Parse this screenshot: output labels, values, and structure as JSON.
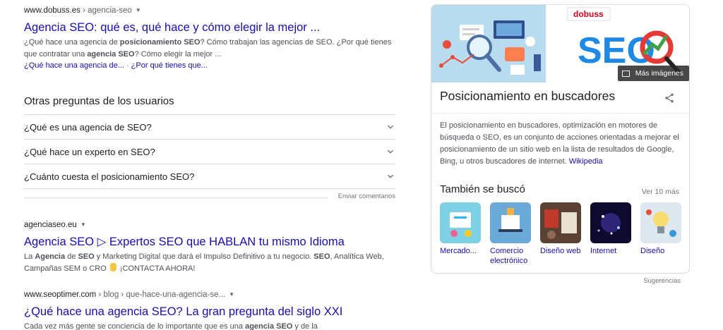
{
  "results": [
    {
      "domain": "www.dobuss.es",
      "path": " › agencia-seo",
      "title": "Agencia SEO: qué es, qué hace y cómo elegir la mejor ...",
      "snippet_html": "¿Qué hace una agencia de <b>posicionamiento SEO</b>? Cómo trabajan las agencias de SEO. ¿Por qué tienes que contratar una <b>agencia SEO</b>? Cómo elegir la mejor ...",
      "sitelinks": [
        "¿Qué hace una agencia de...",
        "¿Por qué tienes que..."
      ]
    },
    {
      "domain": "agenciaseo.eu",
      "path": "",
      "title": "Agencia SEO ▷ Expertos SEO que HABLAN tu mismo Idioma",
      "snippet_html": "La <b>Agencia</b> de <b>SEO</b> y Marketing Digital que dará el Impulso Definitivo a tu negocio. <b>SEO</b>, Analítica Web, Campañas SEM o CRO <span class=\"hand\"></span> ¡CONTACTA AHORA!"
    },
    {
      "domain": "www.seoptimer.com",
      "path": " › blog › que-hace-una-agencia-se...",
      "title": "¿Qué hace una agencia SEO? La gran pregunta del siglo XXI",
      "snippet_html": "Cada vez más gente se conciencia de lo importante que es una <b>agencia SEO</b> y de la"
    }
  ],
  "paa": {
    "heading": "Otras preguntas de los usuarios",
    "questions": [
      "¿Qué es una agencia de SEO?",
      "¿Qué hace un experto en SEO?",
      "¿Cuánto cuesta el posicionamiento SEO?"
    ],
    "feedback": "Enviar comentarios"
  },
  "knowledge_panel": {
    "brand_logo": "dobuss",
    "seo_logo_text": "SEO",
    "more_images": "Más imágenes",
    "title": "Posicionamiento en buscadores",
    "description": "El posicionamiento en buscadores, optimización en motores de búsqueda o SEO, es un conjunto de acciones orientadas a mejorar el posicionamiento de un sitio web en la lista de resultados de Google, Bing, u otros buscadores de internet.",
    "source": "Wikipedia",
    "also_searched_heading": "También se buscó",
    "see_more": "Ver 10 más",
    "related": [
      "Mercado...",
      "Comercio electrónico",
      "Diseño web",
      "Internet",
      "Diseño"
    ],
    "suggestions": "Sugerencias"
  },
  "colors": {
    "link": "#1a0dab",
    "text": "#202124",
    "muted": "#70757a"
  }
}
